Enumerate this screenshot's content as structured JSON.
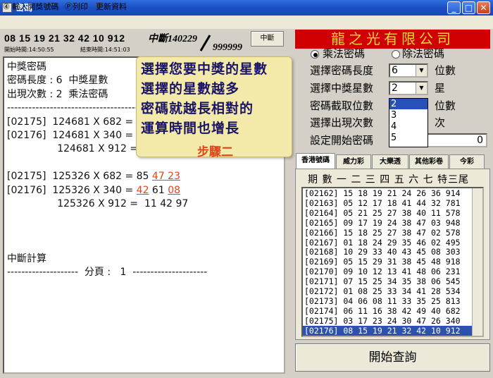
{
  "window": {
    "title": "密碼",
    "min": "_",
    "max": "□",
    "close": "✕"
  },
  "menu": [
    "④ 輸入開獎號碼",
    "Ⓟ列印",
    "更新資料"
  ],
  "header": {
    "numbers": "08 15 19 21 32 42 10 912",
    "start_time": "開始時間:14:50:55",
    "end_time": "結束時間:14:51:03",
    "interrupt_count": "中斷140229",
    "total": "999999",
    "interrupt_button": "中斷"
  },
  "result": {
    "lines": [
      {
        "parts": [
          {
            "t": "中獎密碼"
          }
        ]
      },
      {
        "parts": [
          {
            "t": "密碼長度 : 6  中獎星數"
          }
        ]
      },
      {
        "parts": [
          {
            "t": "出現次數 : 2  乘法密碼"
          }
        ]
      },
      {
        "parts": [
          {
            "t": "------------------------------------------------"
          }
        ]
      },
      {
        "parts": [
          {
            "t": "[02175]  124681 X 682 = "
          }
        ]
      },
      {
        "parts": [
          {
            "t": "[02176]  124681 X 340 = "
          }
        ]
      },
      {
        "parts": [
          {
            "t": "                124681 X 912 =  11 37 09"
          }
        ]
      },
      {
        "parts": [
          {
            "t": ""
          }
        ]
      },
      {
        "parts": [
          {
            "t": "[02175]  125326 X 682 = 85 "
          },
          {
            "t": "47 23",
            "red": true
          }
        ]
      },
      {
        "parts": [
          {
            "t": "[02176]  125326 X 340 = "
          },
          {
            "t": "42",
            "red": true
          },
          {
            "t": " 61 "
          },
          {
            "t": "08",
            "red": true
          }
        ]
      },
      {
        "parts": [
          {
            "t": "                125326 X 912 =  11 42 97"
          }
        ]
      },
      {
        "parts": [
          {
            "t": ""
          }
        ]
      },
      {
        "parts": [
          {
            "t": ""
          }
        ]
      },
      {
        "parts": [
          {
            "t": ""
          }
        ]
      },
      {
        "parts": [
          {
            "t": "中斷計算"
          }
        ]
      },
      {
        "parts": [
          {
            "t": "--------------------  分頁 :   1  ---------------------"
          }
        ]
      }
    ]
  },
  "callout": {
    "lines": [
      "選擇您要中獎的星數",
      "選擇的星數越多",
      "密碼就越長相對的",
      "運算時間也增長"
    ],
    "step": "步驟二"
  },
  "company": "龍之光有限公司",
  "settings": {
    "radio_multiply": "乘法密碼",
    "radio_divide": "除法密碼",
    "length_label": "選擇密碼長度",
    "length_value": "6",
    "length_unit": "位數",
    "stars_label": "選擇中獎星數",
    "stars_value": "2",
    "stars_unit": "星",
    "cut_label": "密碼截取位數",
    "cut_unit": "位數",
    "count_label": "選擇出現次數",
    "count_unit": "次",
    "start_label": "設定開始密碼",
    "start_value": "0",
    "dropdown_options": [
      "2",
      "3",
      "4",
      "5"
    ]
  },
  "tabs": [
    "香港號碼",
    "威力彩",
    "大樂透",
    "其他彩卷",
    "今彩"
  ],
  "history": {
    "header": "期 數   一 二 三 四 五 六 七 特三尾",
    "rows": [
      "[02162] 15 18 19 21 24 26 36 914",
      "[02163] 05 12 17 18 41 44 32 781",
      "[02164] 05 21 25 27 38 40 11 578",
      "[02165] 09 17 19 24 38 47 03 948",
      "[02166] 15 18 25 27 38 47 02 578",
      "[02167] 01 18 24 29 35 46 02 495",
      "[02168] 10 29 33 40 43 45 08 303",
      "[02169] 05 15 29 31 38 45 48 918",
      "[02170] 09 10 12 13 41 48 06 231",
      "[02171] 07 15 25 34 35 38 06 545",
      "[02172] 01 08 25 33 34 41 28 534",
      "[02173] 04 06 08 11 33 35 25 813",
      "[02174] 06 11 16 38 42 49 40 682",
      "[02175] 03 17 23 24 30 47 26 340",
      "[02176] 08 15 19 21 32 42 10 912"
    ]
  },
  "query_button": "開始查詢"
}
